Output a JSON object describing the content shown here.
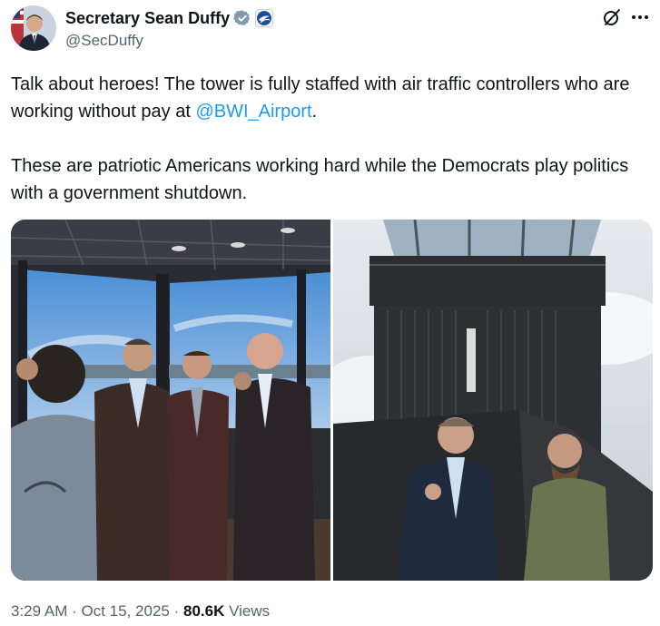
{
  "tweet": {
    "author_name": "Secretary Sean Duffy",
    "author_handle": "@SecDuffy",
    "paragraph1_text": "Talk about heroes! The tower is fully staffed with air traffic controllers who are working without pay at ",
    "mention": "@BWI_Airport",
    "paragraph1_end": ".",
    "paragraph2": "These are patriotic Americans working hard while the Democrats play politics with a government shutdown.",
    "time": "3:29 AM",
    "date": "Oct 15, 2025",
    "views_count": "80.6K",
    "views_label": "Views",
    "separator": "·"
  },
  "icons": {
    "verified": "verified-badge-icon",
    "affiliate": "dot-seal-icon",
    "grok": "grok-icon",
    "more": "more-icon"
  },
  "colors": {
    "text": "#0f1419",
    "secondary": "#536471",
    "link": "#1d9bf0"
  }
}
